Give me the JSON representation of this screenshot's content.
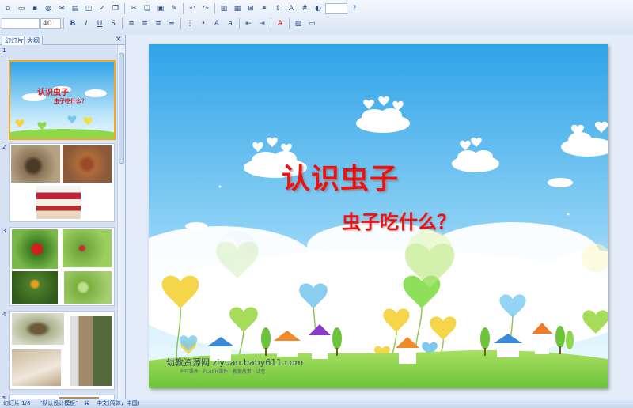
{
  "toolbar": {
    "font_name": "",
    "font_size": "40",
    "zoom": ""
  },
  "left_pane": {
    "tab_slides": "幻灯片",
    "tab_outline": "大纲",
    "close": "×",
    "slide_numbers": [
      "1",
      "2",
      "3",
      "4",
      "5"
    ],
    "thumb1_title": "认识虫子",
    "thumb1_subtitle": "虫子吃什么？"
  },
  "slide": {
    "title": "认识虫子",
    "subtitle": "虫子吃什么？",
    "watermark": "幼教资源网 ziyuan.baby611.com",
    "watermark_sub": "PPT课件 · FLASH课件 · 教案故事 · 试卷"
  },
  "status_bar": {
    "slide_counter": "幻灯片 1/8",
    "template": "\"默认设计模板\"",
    "language": "中文(简体，中国)"
  },
  "colors": {
    "sky_top": "#2fa4e7",
    "sky_bottom": "#bfe6fb",
    "title_red": "#ee1111",
    "grass": "#8ed84a",
    "selection": "#f5a623"
  }
}
